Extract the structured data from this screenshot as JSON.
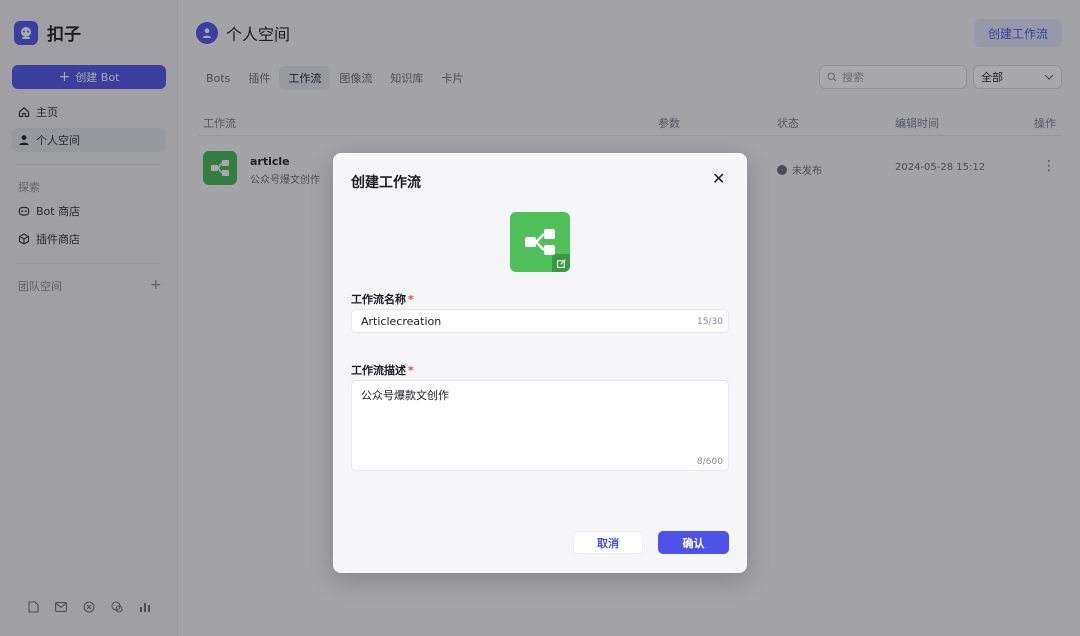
{
  "app": {
    "brand_name": "扣子"
  },
  "sidebar": {
    "create_bot_label": "创建 Bot",
    "nav": [
      {
        "label": "主页",
        "icon": "home-icon"
      },
      {
        "label": "个人空间",
        "icon": "user-icon"
      }
    ],
    "explore_label": "探索",
    "explore_items": [
      {
        "label": "Bot 商店",
        "icon": "bot-icon"
      },
      {
        "label": "插件商店",
        "icon": "plugin-cube-icon"
      }
    ],
    "team_space_label": "团队空间",
    "footer_icons": [
      "document-icon",
      "mail-icon",
      "settings-circle-icon",
      "chat-icon",
      "chart-icon"
    ]
  },
  "header": {
    "title": "个人空间",
    "create_workflow_label": "创建工作流"
  },
  "tabs": [
    "Bots",
    "插件",
    "工作流",
    "图像流",
    "知识库",
    "卡片"
  ],
  "active_tab": "工作流",
  "search": {
    "placeholder": "搜索"
  },
  "filter": {
    "value": "全部"
  },
  "table": {
    "columns": {
      "name": "工作流",
      "params": "参数",
      "status": "状态",
      "edited": "编辑时间",
      "actions": "操作"
    },
    "rows": [
      {
        "name": "article",
        "desc": "公众号爆文创作",
        "status": "未发布",
        "edited": "2024-05-28 15:12"
      }
    ]
  },
  "modal": {
    "title": "创建工作流",
    "name_label": "工作流名称",
    "name_value": "Articlecreation",
    "name_count": "15/30",
    "desc_label": "工作流描述",
    "desc_value": "公众号爆款文创作",
    "desc_count": "8/600",
    "cancel_label": "取消",
    "confirm_label": "确认",
    "required_mark": "*"
  },
  "colors": {
    "accent": "#4d53e8",
    "workflow_icon": "#4fc05a",
    "required": "#ef4444"
  }
}
